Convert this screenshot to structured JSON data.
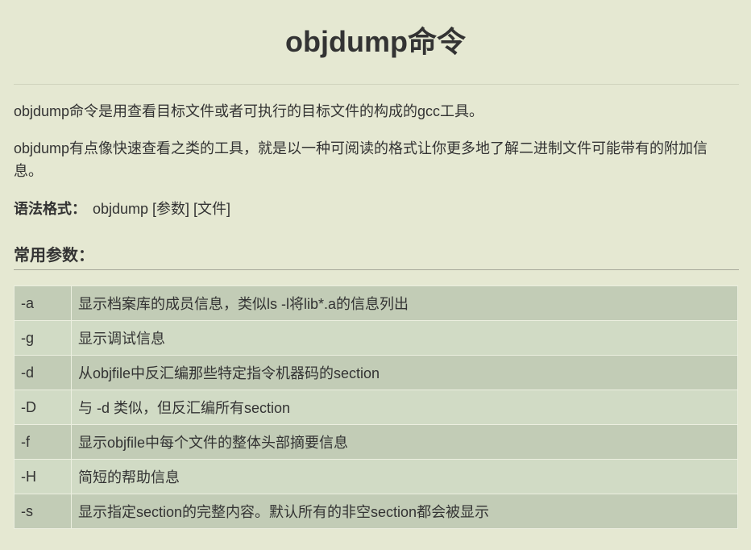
{
  "title": "objdump命令",
  "paragraphs": [
    "objdump命令是用查看目标文件或者可执行的目标文件的构成的gcc工具。",
    "objdump有点像快速查看之类的工具，就是以一种可阅读的格式让你更多地了解二进制文件可能带有的附加信息。"
  ],
  "syntax": {
    "label": "语法格式：",
    "value": "objdump [参数] [文件]"
  },
  "params_heading": "常用参数：",
  "params": [
    {
      "flag": "-a",
      "desc": "显示档案库的成员信息，类似ls -l将lib*.a的信息列出"
    },
    {
      "flag": "-g",
      "desc": "显示调试信息"
    },
    {
      "flag": "-d",
      "desc": "从objfile中反汇编那些特定指令机器码的section"
    },
    {
      "flag": "-D",
      "desc": "与 -d 类似，但反汇编所有section"
    },
    {
      "flag": "-f",
      "desc": "显示objfile中每个文件的整体头部摘要信息"
    },
    {
      "flag": "-H",
      "desc": "简短的帮助信息"
    },
    {
      "flag": "-s",
      "desc": "显示指定section的完整内容。默认所有的非空section都会被显示"
    }
  ]
}
